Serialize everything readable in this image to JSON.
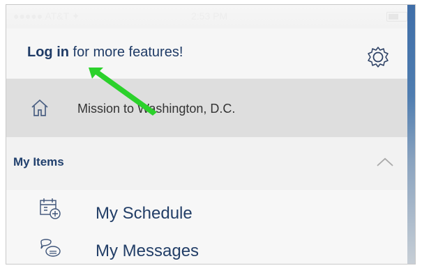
{
  "status": {
    "carrier": "●●●●● AT&T ✦",
    "time": "2:53 PM"
  },
  "login": {
    "bold": "Log in",
    "rest": " for more features!"
  },
  "home": {
    "label": "Mission to Washington, D.C."
  },
  "section": {
    "title": "My Items"
  },
  "menu": [
    {
      "label": "My Schedule"
    },
    {
      "label": "My Messages"
    }
  ],
  "colors": {
    "accent": "#1f3b66",
    "arrow": "#2ecc2e"
  }
}
